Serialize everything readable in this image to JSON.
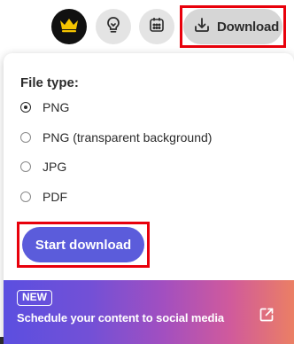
{
  "toolbar": {
    "download_label": "Download",
    "icons": {
      "premium": "crown-icon",
      "ideas": "lightbulb-icon",
      "calendar": "calendar-icon",
      "download": "download-icon"
    }
  },
  "download_panel": {
    "file_type_title": "File type:",
    "options": [
      {
        "label": "PNG",
        "selected": true
      },
      {
        "label": "PNG (transparent background)",
        "selected": false
      },
      {
        "label": "JPG",
        "selected": false
      },
      {
        "label": "PDF",
        "selected": false
      }
    ],
    "start_button_label": "Start download"
  },
  "promo": {
    "badge": "NEW",
    "text": "Schedule your content to social media",
    "icon": "external-link-icon"
  },
  "colors": {
    "accent": "#5b5cdb",
    "highlight": "#e8000b",
    "crown": "#f5c400"
  }
}
